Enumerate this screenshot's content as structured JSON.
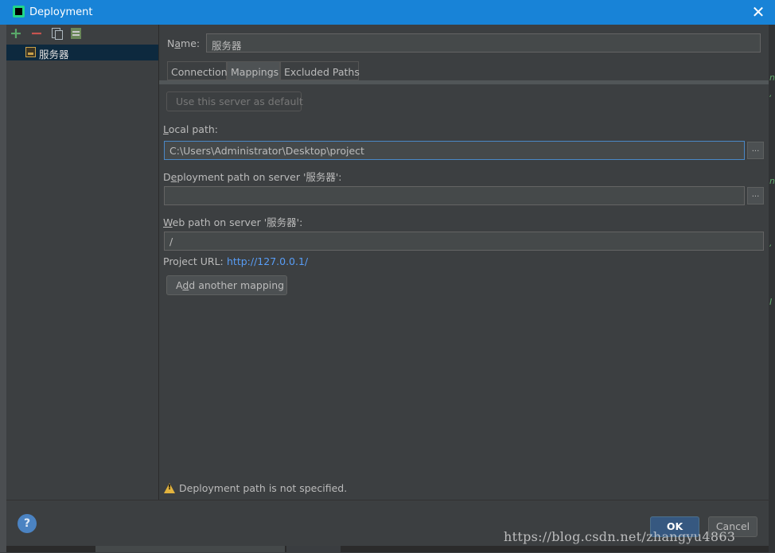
{
  "window": {
    "title": "Deployment"
  },
  "sidebar": {
    "toolbar": {
      "add": "+",
      "remove": "−"
    },
    "servers": [
      {
        "label": "服务器",
        "selected": true
      }
    ]
  },
  "form": {
    "name_label_pre": "N",
    "name_label_u": "a",
    "name_label_post": "me:",
    "name_value": "服务器",
    "tabs": [
      {
        "label": "Connection",
        "active": false
      },
      {
        "label": "Mappings",
        "active": true
      },
      {
        "label": "Excluded Paths",
        "active": false
      }
    ],
    "default_button": "Use this server as default",
    "local_path_label_u": "L",
    "local_path_label_rest": "ocal path:",
    "local_path_value": "C:\\Users\\Administrator\\Desktop\\project",
    "deployment_path_label_pre": "D",
    "deployment_path_label_u": "e",
    "deployment_path_label_post": "ployment path on server '服务器':",
    "deployment_path_value": "",
    "web_path_label_u": "W",
    "web_path_label_rest": "eb path on server '服务器':",
    "web_path_value": "/",
    "project_url_label": "Project URL:",
    "project_url": "http://127.0.0.1/",
    "add_mapping_pre": "A",
    "add_mapping_u": "d",
    "add_mapping_post": "d another mapping",
    "browse": "...",
    "warning": "Deployment path is not specified."
  },
  "footer": {
    "help": "?",
    "ok": "OK",
    "cancel": "Cancel"
  },
  "watermark": "https://blog.csdn.net/zhangyu4863",
  "colors": {
    "accent": "#1883d7",
    "link": "#589df6",
    "selection": "#0d293e",
    "warning": "#e2b33e"
  },
  "icons": [
    "app-icon",
    "close-icon",
    "add-icon",
    "remove-icon",
    "copy-icon",
    "set-default-icon",
    "server-icon",
    "warning-icon",
    "help-icon"
  ]
}
